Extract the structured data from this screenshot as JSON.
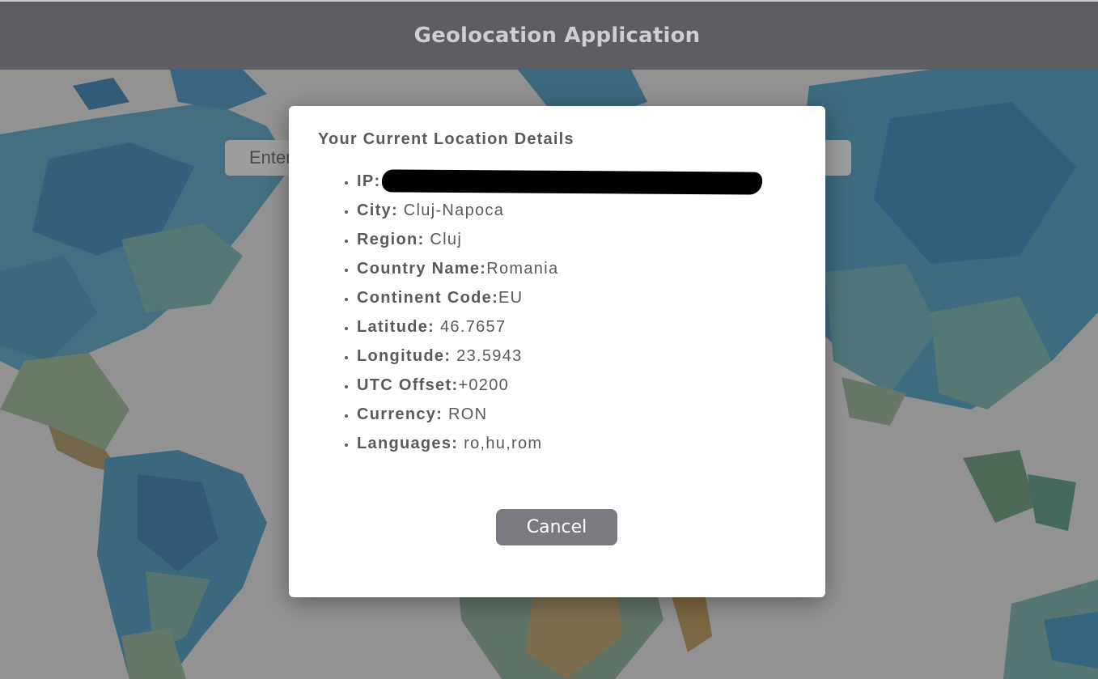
{
  "header": {
    "title": "Geolocation Application"
  },
  "search": {
    "placeholder": "Enter"
  },
  "modal": {
    "title": "Your Current Location Details",
    "items": [
      {
        "label": "IP:",
        "value": ""
      },
      {
        "label": "City:",
        "value": " Cluj-Napoca"
      },
      {
        "label": "Region:",
        "value": " Cluj"
      },
      {
        "label": "Country Name:",
        "value": "Romania"
      },
      {
        "label": "Continent Code:",
        "value": "EU"
      },
      {
        "label": "Latitude:",
        "value": " 46.7657"
      },
      {
        "label": "Longitude:",
        "value": " 23.5943"
      },
      {
        "label": "UTC Offset:",
        "value": "+0200"
      },
      {
        "label": "Currency:",
        "value": " RON"
      },
      {
        "label": "Languages:",
        "value": " ro,hu,rom"
      }
    ],
    "cancel_label": "Cancel"
  },
  "colors": {
    "header_bg": "#5d5e63",
    "button_bg": "#7a7b81",
    "map_blue": "#2f86b8",
    "map_teal": "#5aa6a8",
    "map_sand": "#b59a5a"
  }
}
